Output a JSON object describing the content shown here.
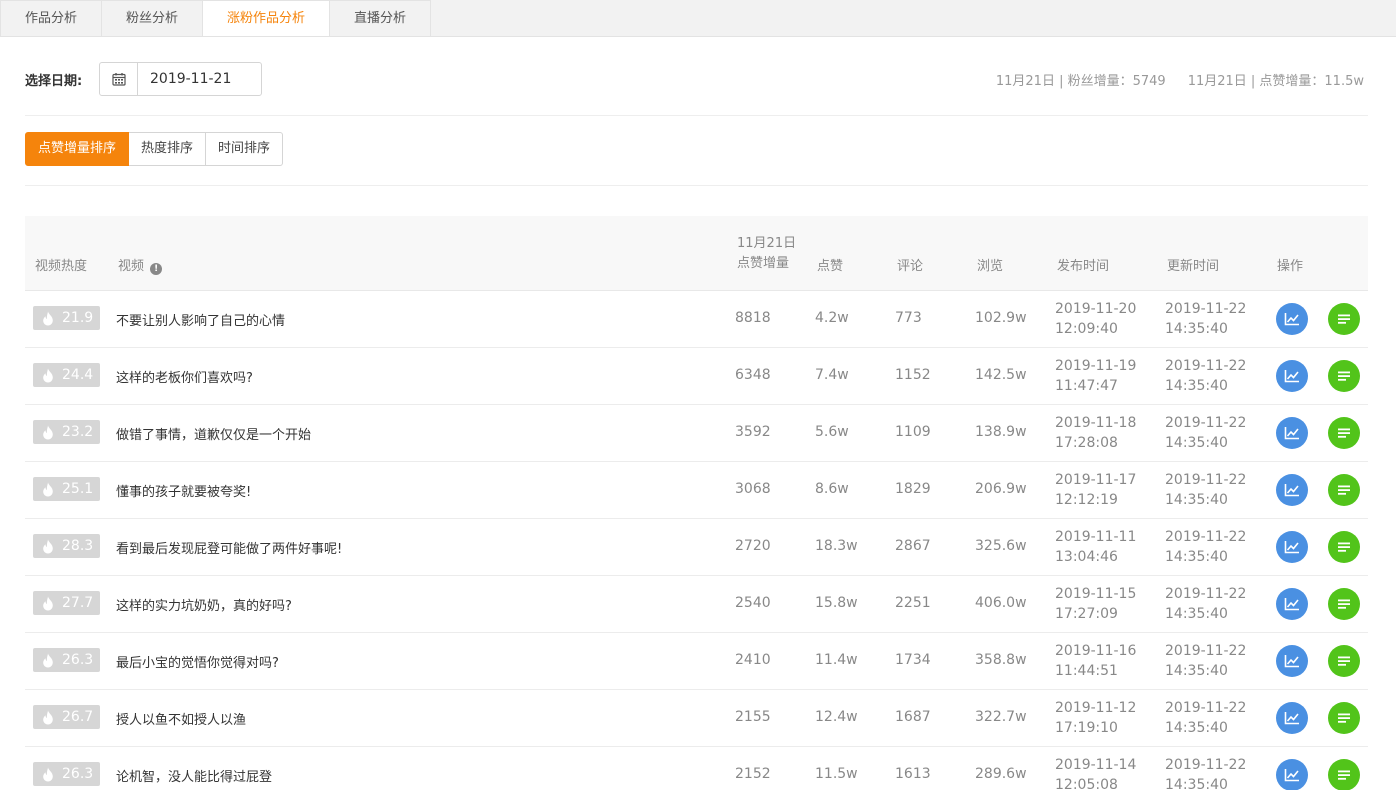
{
  "tabs": [
    {
      "label": "作品分析",
      "active": false
    },
    {
      "label": "粉丝分析",
      "active": false
    },
    {
      "label": "涨粉作品分析",
      "active": true
    },
    {
      "label": "直播分析",
      "active": false
    }
  ],
  "date": {
    "label": "选择日期:",
    "value": "2019-11-21"
  },
  "stats": {
    "fans": "11月21日 | 粉丝增量：5749",
    "likes": "11月21日 | 点赞增量：11.5w"
  },
  "sort": [
    "点赞增量排序",
    "热度排序",
    "时间排序"
  ],
  "columns": {
    "heat": "视频热度",
    "video": "视频",
    "inc_line1": "11月21日",
    "inc_line2": "点赞增量",
    "likes": "点赞",
    "comments": "评论",
    "views": "浏览",
    "publish": "发布时间",
    "update": "更新时间",
    "ops": "操作"
  },
  "rows": [
    {
      "heat": "21.9",
      "title": "不要让别人影响了自己的心情",
      "inc": "8818",
      "likes": "4.2w",
      "comments": "773",
      "views": "102.9w",
      "pub_date": "2019-11-20",
      "pub_time": "12:09:40",
      "upd_date": "2019-11-22",
      "upd_time": "14:35:40"
    },
    {
      "heat": "24.4",
      "title": "这样的老板你们喜欢吗?",
      "inc": "6348",
      "likes": "7.4w",
      "comments": "1152",
      "views": "142.5w",
      "pub_date": "2019-11-19",
      "pub_time": "11:47:47",
      "upd_date": "2019-11-22",
      "upd_time": "14:35:40"
    },
    {
      "heat": "23.2",
      "title": "做错了事情，道歉仅仅是一个开始",
      "inc": "3592",
      "likes": "5.6w",
      "comments": "1109",
      "views": "138.9w",
      "pub_date": "2019-11-18",
      "pub_time": "17:28:08",
      "upd_date": "2019-11-22",
      "upd_time": "14:35:40"
    },
    {
      "heat": "25.1",
      "title": "懂事的孩子就要被夸奖!",
      "inc": "3068",
      "likes": "8.6w",
      "comments": "1829",
      "views": "206.9w",
      "pub_date": "2019-11-17",
      "pub_time": "12:12:19",
      "upd_date": "2019-11-22",
      "upd_time": "14:35:40"
    },
    {
      "heat": "28.3",
      "title": "看到最后发现屁登可能做了两件好事呢!",
      "inc": "2720",
      "likes": "18.3w",
      "comments": "2867",
      "views": "325.6w",
      "pub_date": "2019-11-11",
      "pub_time": "13:04:46",
      "upd_date": "2019-11-22",
      "upd_time": "14:35:40"
    },
    {
      "heat": "27.7",
      "title": "这样的实力坑奶奶，真的好吗?",
      "inc": "2540",
      "likes": "15.8w",
      "comments": "2251",
      "views": "406.0w",
      "pub_date": "2019-11-15",
      "pub_time": "17:27:09",
      "upd_date": "2019-11-22",
      "upd_time": "14:35:40"
    },
    {
      "heat": "26.3",
      "title": "最后小宝的觉悟你觉得对吗?",
      "inc": "2410",
      "likes": "11.4w",
      "comments": "1734",
      "views": "358.8w",
      "pub_date": "2019-11-16",
      "pub_time": "11:44:51",
      "upd_date": "2019-11-22",
      "upd_time": "14:35:40"
    },
    {
      "heat": "26.7",
      "title": "授人以鱼不如授人以渔",
      "inc": "2155",
      "likes": "12.4w",
      "comments": "1687",
      "views": "322.7w",
      "pub_date": "2019-11-12",
      "pub_time": "17:19:10",
      "upd_date": "2019-11-22",
      "upd_time": "14:35:40"
    },
    {
      "heat": "26.3",
      "title": "论机智，没人能比得过屁登",
      "inc": "2152",
      "likes": "11.5w",
      "comments": "1613",
      "views": "289.6w",
      "pub_date": "2019-11-14",
      "pub_time": "12:05:08",
      "upd_date": "2019-11-22",
      "upd_time": "14:35:40"
    }
  ],
  "colors": {
    "accent": "#f5840c",
    "chart_button": "#4a90e2",
    "detail_button": "#52c41a",
    "heat_badge": "#d6d6d6"
  },
  "icons": {
    "date": "calendar-icon",
    "heat": "flame-icon",
    "info": "info-icon",
    "chart": "line-chart-icon",
    "detail": "list-icon"
  }
}
